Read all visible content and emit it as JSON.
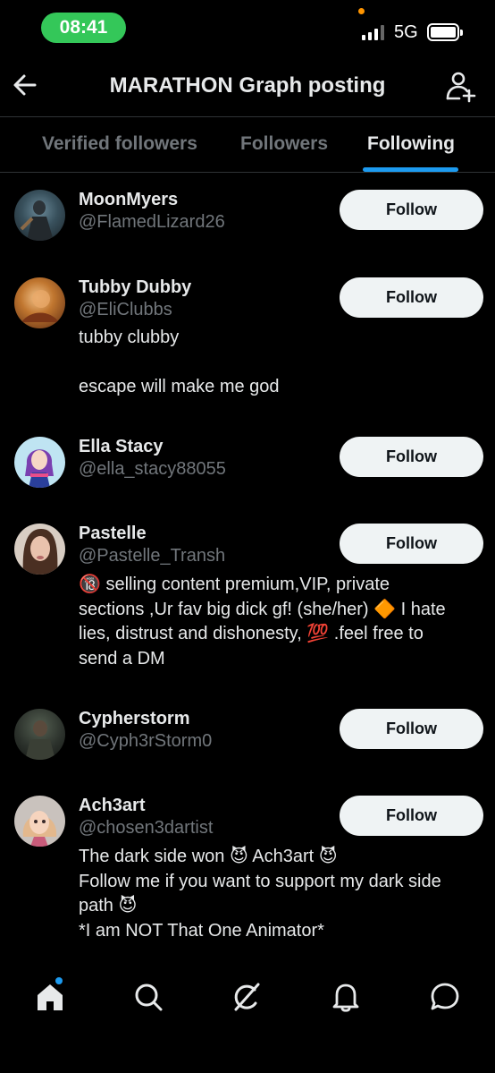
{
  "status_bar": {
    "time": "08:41",
    "network": "5G"
  },
  "header": {
    "title": "MARATHON Graph posting"
  },
  "tabs": [
    {
      "label": "Verified followers",
      "active": false
    },
    {
      "label": "Followers",
      "active": false
    },
    {
      "label": "Following",
      "active": true
    }
  ],
  "users": [
    {
      "name": "MoonMyers",
      "handle": "@FlamedLizard26",
      "bio": [],
      "button": "Follow"
    },
    {
      "name": "Tubby Dubby",
      "handle": "@EliClubbs",
      "bio": [
        "tubby clubby",
        "",
        "escape will make me god"
      ],
      "button": "Follow"
    },
    {
      "name": "Ella Stacy",
      "handle": "@ella_stacy88055",
      "bio": [],
      "button": "Follow"
    },
    {
      "name": "Pastelle",
      "handle": "@Pastelle_Transh",
      "bio": [
        "🔞 selling content premium,VIP, private",
        "sections ,Ur fav big dick gf! (she/her) 🔶 I hate",
        "lies, distrust and dishonesty, 💯 .feel free to",
        "send a DM"
      ],
      "button": "Follow"
    },
    {
      "name": "Cypherstorm",
      "handle": "@Cyph3rStorm0",
      "bio": [],
      "button": "Follow"
    },
    {
      "name": "Ach3art",
      "handle": "@chosen3dartist",
      "bio": [
        "The dark side won 😈 Ach3art 😈",
        "Follow me if you want to support my dark side",
        "path 😈",
        "*I am NOT That One Animator*"
      ],
      "button": "Follow"
    }
  ],
  "bottom_nav": [
    {
      "icon": "home-icon",
      "active": true,
      "badge": true
    },
    {
      "icon": "search-icon"
    },
    {
      "icon": "grok-icon"
    },
    {
      "icon": "bell-icon"
    },
    {
      "icon": "messages-icon"
    }
  ],
  "colors": {
    "accent": "#1d9bf0",
    "status_pill": "#34c759",
    "muted_text": "#71767b"
  }
}
